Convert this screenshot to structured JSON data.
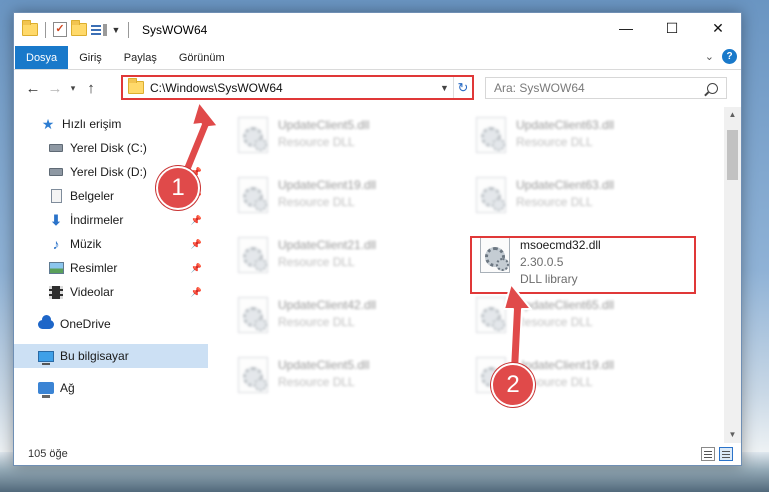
{
  "window": {
    "title": "SysWOW64"
  },
  "ribbon": {
    "tabs": [
      {
        "label": "Dosya"
      },
      {
        "label": "Giriş"
      },
      {
        "label": "Paylaş"
      },
      {
        "label": "Görünüm"
      }
    ],
    "help": "?"
  },
  "nav": {
    "back": "←",
    "forward": "→",
    "recent": "v",
    "up": "↑",
    "address": "C:\\Windows\\SysWOW64",
    "search_placeholder": "Ara: SysWOW64"
  },
  "sidebar": {
    "items": [
      {
        "label": "Hızlı erişim",
        "icon": "star-icon"
      },
      {
        "label": "Yerel Disk (C:)",
        "icon": "drive-icon"
      },
      {
        "label": "Yerel Disk (D:)",
        "icon": "drive-icon"
      },
      {
        "label": "Belgeler",
        "icon": "documents-icon"
      },
      {
        "label": "İndirmeler",
        "icon": "downloads-icon"
      },
      {
        "label": "Müzik",
        "icon": "music-icon"
      },
      {
        "label": "Resimler",
        "icon": "pictures-icon"
      },
      {
        "label": "Videolar",
        "icon": "videos-icon"
      },
      {
        "label": "OneDrive",
        "icon": "onedrive-icon"
      },
      {
        "label": "Bu bilgisayar",
        "icon": "this-pc-icon"
      },
      {
        "label": "Ağ",
        "icon": "network-icon"
      }
    ]
  },
  "files": {
    "left_column": [
      {
        "name": "UpdateClient5.dll",
        "type": "Resource DLL"
      },
      {
        "name": "UpdateClient19.dll",
        "type": "Resource DLL"
      },
      {
        "name": "UpdateClient21.dll",
        "type": "Resource DLL"
      },
      {
        "name": "UpdateClient42.dll",
        "type": "Resource DLL"
      },
      {
        "name": "UpdateClient5.dll",
        "type": "Resource DLL"
      }
    ],
    "right_column": [
      {
        "name": "UpdateClient63.dll",
        "type": "Resource DLL"
      },
      {
        "name": "UpdateClient63.dll",
        "type": "Resource DLL"
      },
      {
        "name": "msoecmd32.dll",
        "type": "2.30.0.5",
        "extra": "DLL library"
      },
      {
        "name": "UpdateClient65.dll",
        "type": "Resource DLL"
      },
      {
        "name": "UpdateClient19.dll",
        "type": "Resource DLL"
      }
    ]
  },
  "status": {
    "item_count": "105 öğe"
  },
  "annotations": {
    "marker1": "1",
    "marker2": "2",
    "accent_color": "#e04a4a"
  }
}
